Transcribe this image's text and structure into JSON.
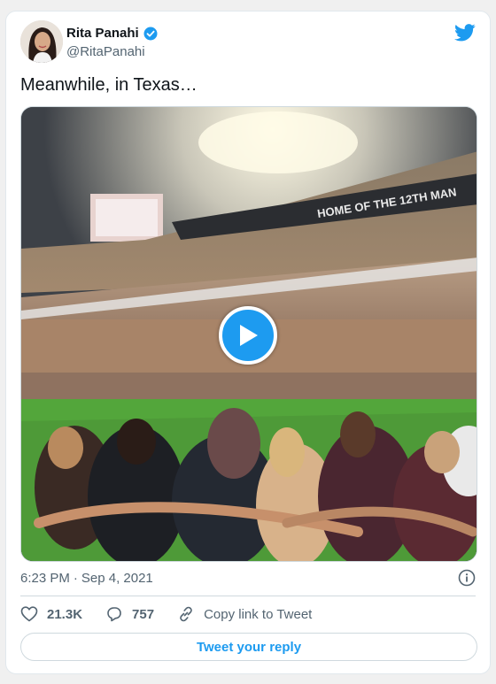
{
  "author": {
    "display_name": "Rita Panahi",
    "handle": "@RitaPanahi",
    "verified": true
  },
  "tweet": {
    "text": "Meanwhile, in Texas…",
    "time": "6:23 PM",
    "separator": "·",
    "date": "Sep 4, 2021"
  },
  "media": {
    "type": "video",
    "scene_text": "HOME OF THE 12TH MAN"
  },
  "actions": {
    "likes": "21.3K",
    "replies": "757",
    "copy_link_label": "Copy link to Tweet"
  },
  "reply_button_label": "Tweet your reply",
  "icons": {
    "brand": "twitter-bird-icon",
    "verified": "verified-badge-icon",
    "play": "play-icon",
    "info": "info-icon",
    "like": "heart-icon",
    "reply": "comment-icon",
    "link": "link-icon"
  },
  "colors": {
    "accent": "#1d9bf0",
    "text": "#0f1419",
    "secondary": "#536471",
    "border": "#cfd9de"
  }
}
